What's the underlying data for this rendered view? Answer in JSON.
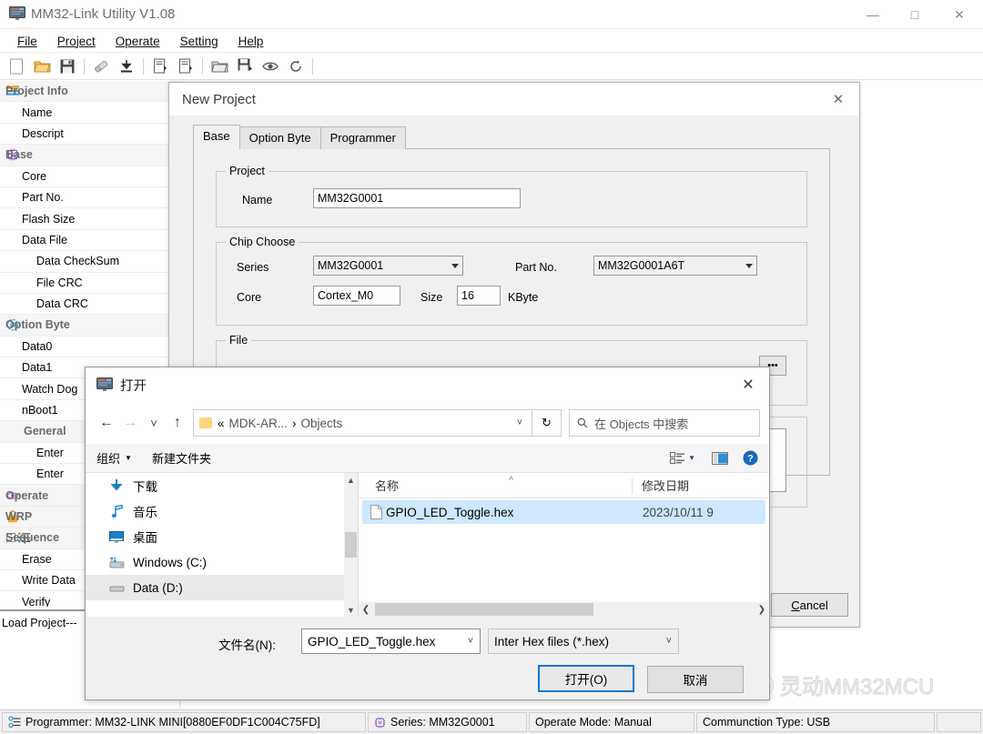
{
  "app": {
    "title": "MM32-Link Utility V1.08",
    "icon": "app-monitor-icon",
    "window_controls": {
      "minimize": "—",
      "maximize": "□",
      "close": "✕"
    }
  },
  "menubar": [
    {
      "label": "File",
      "accel": "F"
    },
    {
      "label": "Project",
      "accel": "P"
    },
    {
      "label": "Operate",
      "accel": "O"
    },
    {
      "label": "Setting",
      "accel": "S"
    },
    {
      "label": "Help",
      "accel": "H"
    }
  ],
  "toolbar": [
    {
      "name": "new-icon"
    },
    {
      "name": "open-folder-icon"
    },
    {
      "name": "save-icon"
    },
    {
      "name": "separator-1"
    },
    {
      "name": "erase-icon"
    },
    {
      "name": "download-icon"
    },
    {
      "name": "separator-2"
    },
    {
      "name": "read-file-icon"
    },
    {
      "name": "write-file-icon"
    },
    {
      "name": "separator-3"
    },
    {
      "name": "open-project-icon"
    },
    {
      "name": "save-project-icon"
    },
    {
      "name": "verify-icon"
    },
    {
      "name": "refresh-icon"
    },
    {
      "name": "separator-4"
    }
  ],
  "tree": [
    {
      "label": "Project Info",
      "type": "group",
      "icon": "project-info-icon",
      "indent": 0
    },
    {
      "label": "Name",
      "type": "item",
      "indent": 1
    },
    {
      "label": "Descript",
      "type": "item",
      "indent": 1
    },
    {
      "label": "Base",
      "type": "group",
      "icon": "chip-icon",
      "indent": 0
    },
    {
      "label": "Core",
      "type": "item",
      "indent": 1
    },
    {
      "label": "Part No.",
      "type": "item",
      "indent": 1
    },
    {
      "label": "Flash Size",
      "type": "item",
      "indent": 1
    },
    {
      "label": "Data File",
      "type": "item",
      "indent": 1
    },
    {
      "label": "Data CheckSum",
      "type": "item",
      "indent": 2
    },
    {
      "label": "File CRC",
      "type": "item",
      "indent": 2
    },
    {
      "label": "Data CRC",
      "type": "item",
      "indent": 2
    },
    {
      "label": "Option Byte",
      "type": "group",
      "icon": "gear-icon",
      "indent": 0
    },
    {
      "label": "Data0",
      "type": "item",
      "indent": 1
    },
    {
      "label": "Data1",
      "type": "item",
      "indent": 1
    },
    {
      "label": "Watch Dog",
      "type": "item",
      "indent": 1
    },
    {
      "label": "nBoot1",
      "type": "item",
      "indent": 1
    },
    {
      "label": "General",
      "type": "subgroup",
      "indent": 1
    },
    {
      "label": "Enter",
      "type": "item",
      "indent": 2
    },
    {
      "label": "Enter",
      "type": "item",
      "indent": 2
    },
    {
      "label": "Operate",
      "type": "group",
      "icon": "operate-icon",
      "indent": 0
    },
    {
      "label": "WRP",
      "type": "group",
      "icon": "lock-icon",
      "indent": 0
    },
    {
      "label": "Sequence",
      "type": "group",
      "icon": "sequence-icon",
      "indent": 0,
      "expander": "−"
    },
    {
      "label": "Erase",
      "type": "item",
      "indent": 1
    },
    {
      "label": "Write Data",
      "type": "item",
      "indent": 1
    },
    {
      "label": "Verify",
      "type": "item",
      "indent": 1
    }
  ],
  "tree_status": "Load Project---",
  "watermark": {
    "text": "灵动MM32MCU",
    "logo": "wechat-icon"
  },
  "statusbar": [
    {
      "icon": "programmer-icon",
      "text": "Programmer: MM32-LINK MINI[0880EF0DF1C004C75FD]"
    },
    {
      "icon": "chip-icon",
      "text": "Series: MM32G0001"
    },
    {
      "icon": "",
      "text": "Operate Mode:  Manual"
    },
    {
      "icon": "",
      "text": "Communction Type: USB"
    },
    {
      "icon": "",
      "text": ""
    }
  ],
  "new_project_dialog": {
    "title": "New Project",
    "close_icon": "✕",
    "tabs": [
      {
        "label": "Base",
        "active": true
      },
      {
        "label": "Option Byte",
        "active": false
      },
      {
        "label": "Programmer",
        "active": false
      }
    ],
    "project_group": {
      "legend": "Project",
      "name_label": "Name",
      "name_value": "MM32G0001"
    },
    "chip_group": {
      "legend": "Chip Choose",
      "series_label": "Series",
      "series_value": "MM32G0001",
      "part_label": "Part No.",
      "part_value": "MM32G0001A6T",
      "core_label": "Core",
      "core_value": "Cortex_M0",
      "size_label": "Size",
      "size_value": "16",
      "size_unit": "KByte"
    },
    "file_group": {
      "legend": "File",
      "browse_label": "•••"
    },
    "cancel_label": "Cancel",
    "cancel_accel": "C"
  },
  "open_dialog": {
    "title": "打开",
    "title_icon": "app-monitor-icon",
    "close_icon": "✕",
    "nav": {
      "back_icon": "←",
      "forward_icon": "→",
      "recent_icon": "˅",
      "up_icon": "↑",
      "refresh_icon": "↻",
      "crumb_prefix": "«",
      "crumb_parent": "MDK-AR...",
      "crumb_sep": "›",
      "crumb_current": "Objects",
      "crumb_dropdown": "˅",
      "search_placeholder": "在 Objects 中搜索",
      "search_icon": "search-icon"
    },
    "toolbar": {
      "organize": "组织",
      "organize_arrow": "▼",
      "new_folder": "新建文件夹",
      "view_icon": "view-list-icon",
      "view_arrow": "▼",
      "pane_icon": "preview-pane-icon",
      "help_icon": "help-icon"
    },
    "places": [
      {
        "label": "下载",
        "icon": "downloads-icon",
        "selected": false
      },
      {
        "label": "音乐",
        "icon": "music-icon",
        "selected": false
      },
      {
        "label": "桌面",
        "icon": "desktop-icon",
        "selected": false
      },
      {
        "label": "Windows (C:)",
        "icon": "drive-windows-icon",
        "selected": false
      },
      {
        "label": "Data (D:)",
        "icon": "drive-icon",
        "selected": true
      }
    ],
    "columns": [
      {
        "label": "名称",
        "sort": "˄"
      },
      {
        "label": "修改日期"
      }
    ],
    "files": [
      {
        "name": "GPIO_LED_Toggle.hex",
        "date": "2023/10/11 9",
        "icon": "file-icon",
        "selected": true
      }
    ],
    "footer": {
      "filename_label": "文件名(N):",
      "filename_accel": "N",
      "filename_value": "GPIO_LED_Toggle.hex",
      "filetype_value": "Inter Hex files (*.hex)",
      "open_label": "打开(O)",
      "open_accel": "O",
      "cancel_label": "取消",
      "dropdown_icon": "˅"
    }
  },
  "colors": {
    "accent": "#0078d7",
    "selection": "#cde8ff",
    "folder": "#fcd67a",
    "chrome": "#f0f0f0"
  }
}
